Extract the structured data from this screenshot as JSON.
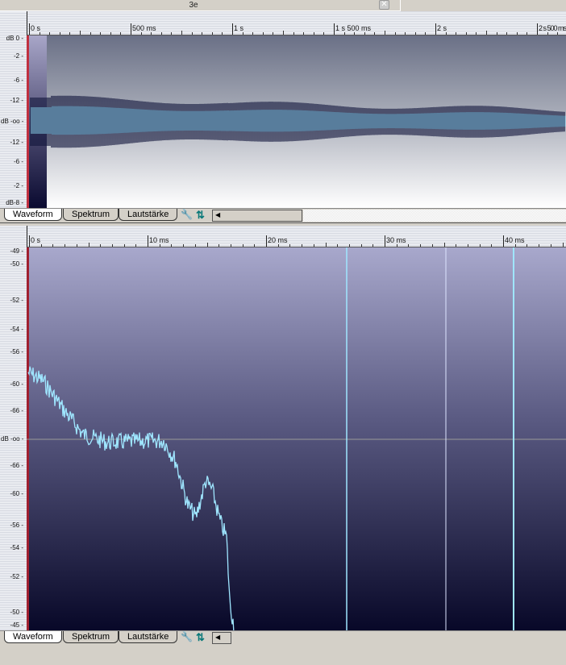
{
  "window": {
    "title": "3e",
    "close_icon": "close-icon"
  },
  "top_panel": {
    "ruler": [
      "0 s",
      "500 ms",
      "1 s",
      "1 s 500 ms",
      "2 s",
      "2 s 500 ms"
    ],
    "y_labels": [
      "dB 0",
      "-2",
      "-6",
      "-12",
      "dB -oo",
      "-12",
      "-6",
      "-2",
      "dB-8"
    ]
  },
  "bottom_panel": {
    "ruler": [
      "0 s",
      "10 ms",
      "20 ms",
      "30 ms",
      "40 ms"
    ],
    "y_labels": [
      "-49",
      "-50",
      "-52",
      "-54",
      "-56",
      "-60",
      "-66",
      "dB -oo",
      "-66",
      "-60",
      "-56",
      "-54",
      "-52",
      "-50",
      "-45"
    ]
  },
  "tabs": [
    "Waveform",
    "Spektrum",
    "Lautstärke"
  ],
  "active_tab": "Waveform",
  "colors": {
    "wave": "#9fe6ff",
    "wave_dark": "#10143a",
    "marker": "#c03040"
  }
}
